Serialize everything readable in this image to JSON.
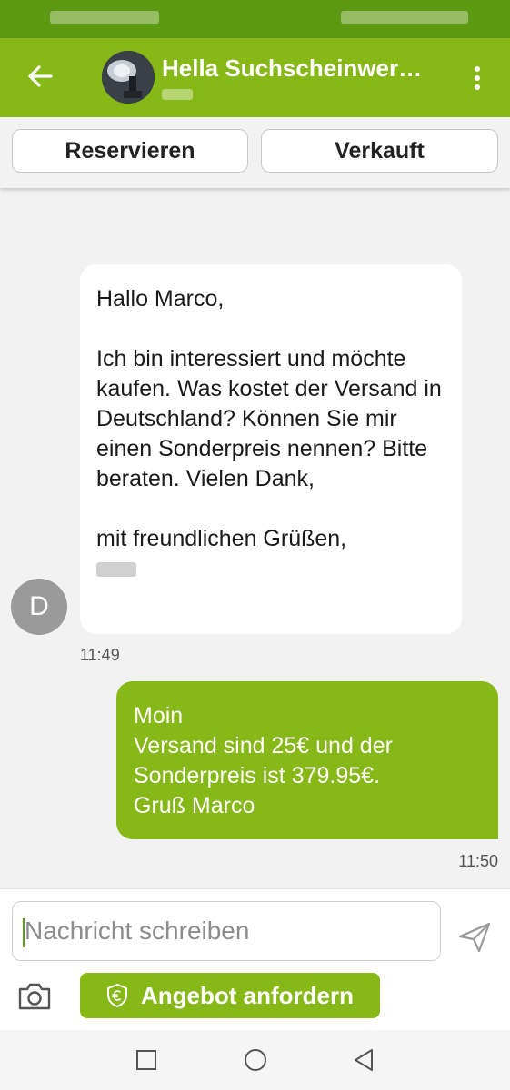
{
  "header": {
    "title": "Hella Suchscheinwer…",
    "back_icon": "arrow-left-icon",
    "more_icon": "more-vertical-icon"
  },
  "actions": {
    "reserve_label": "Reservieren",
    "sold_label": "Verkauft"
  },
  "messages": [
    {
      "direction": "incoming",
      "avatar_letter": "D",
      "greeting": "Hallo Marco,",
      "body": "Ich bin interessiert und möchte kaufen. Was kostet der Versand in Deutschland? Können Sie mir einen Sonderpreis nennen? Bitte beraten. Vielen Dank,",
      "closing": "mit freundlichen Grüßen,",
      "time": "11:49"
    },
    {
      "direction": "outgoing",
      "lines": [
        "Moin",
        "Versand sind 25€ und der",
        "Sonderpreis ist 379.95€.",
        "Gruß Marco"
      ],
      "time": "11:50"
    }
  ],
  "composer": {
    "placeholder": "Nachricht schreiben",
    "offer_label": "Angebot anfordern",
    "send_icon": "send-icon",
    "camera_icon": "camera-icon",
    "offer_icon": "euro-shield-icon"
  },
  "navigation": {
    "icons": [
      "square-recents-icon",
      "circle-home-icon",
      "triangle-back-icon"
    ]
  },
  "colors": {
    "brand_green": "#86b817",
    "status_green": "#5d9a14",
    "background": "#f2f2f2"
  }
}
